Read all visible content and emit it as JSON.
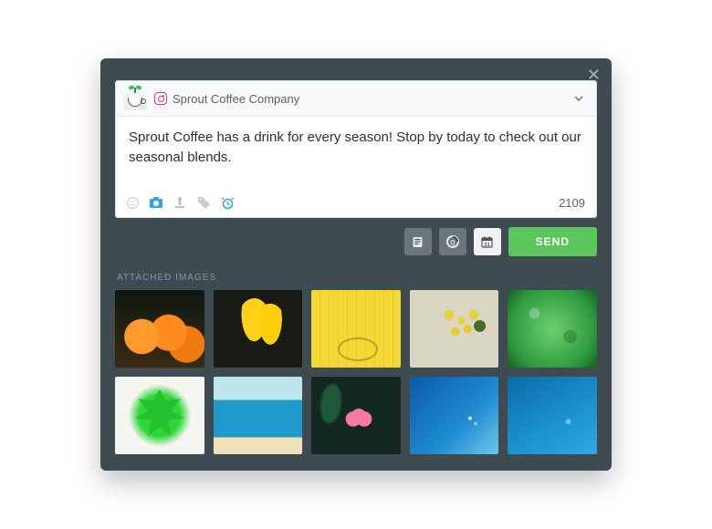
{
  "account": {
    "platform_icon": "instagram-icon",
    "name": "Sprout Coffee Company"
  },
  "composer": {
    "message": "Sprout Coffee has a drink for every season! Stop by today to check out our seasonal blends.",
    "char_count": "2109",
    "tools": {
      "emoji": "emoji-icon",
      "camera": "camera-icon",
      "stamp": "stamp-icon",
      "tag": "tag-icon",
      "alarm": "alarm-icon"
    }
  },
  "actions": {
    "notes": "notes-icon",
    "queue": "queue-icon",
    "calendar": "calendar-icon",
    "send_label": "SEND"
  },
  "attached": {
    "label": "ATTACHED IMAGES",
    "images": [
      {
        "name": "pumpkins"
      },
      {
        "name": "yellow-tulips"
      },
      {
        "name": "yellow-wall-bicycle"
      },
      {
        "name": "mimosa-flowers"
      },
      {
        "name": "green-lettuce"
      },
      {
        "name": "maple-leaves"
      },
      {
        "name": "beach-shore"
      },
      {
        "name": "pink-flower-darkbg"
      },
      {
        "name": "ocean-aerial-rocks"
      },
      {
        "name": "ocean-aerial-plain"
      }
    ]
  }
}
